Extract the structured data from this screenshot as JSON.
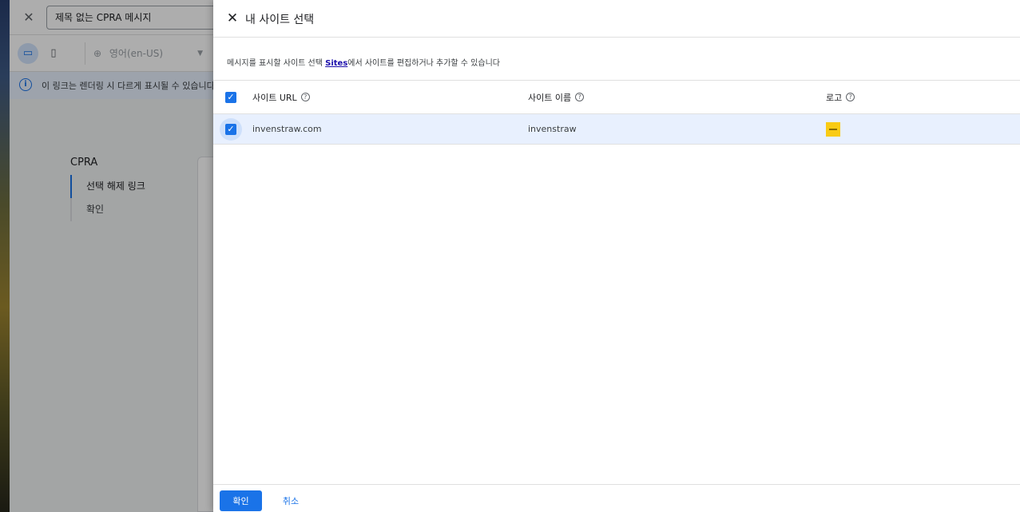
{
  "background_editor": {
    "message_title": "제목 없는 CPRA 메시지",
    "language": "영어(en-US)",
    "info_text": "이 링크는 렌더링 시 다르게 표시될 수 있습니다.",
    "nav": {
      "heading": "CPRA",
      "items": [
        {
          "label": "선택 해제 링크"
        },
        {
          "label": "확인"
        }
      ]
    }
  },
  "dialog": {
    "title": "내 사이트 선택",
    "description_before": "메시지를 표시할 사이트 선택 ",
    "description_link": "Sites",
    "description_after": "에서 사이트를 편집하거나 추가할 수 있습니다",
    "table": {
      "columns": [
        "사이트 URL",
        "사이트 이름",
        "로고"
      ],
      "rows": [
        {
          "url": "invenstraw.com",
          "name": "invenstraw",
          "logo_color": "#f9cb14",
          "selected": true
        }
      ],
      "select_all_checked": true
    },
    "confirm_label": "확인",
    "cancel_label": "취소"
  },
  "icons": {
    "close": "close-icon",
    "desktop": "desktop-icon",
    "mobile": "mobile-icon",
    "globe": "globe-icon",
    "info": "info-icon",
    "help": "help-circle-icon",
    "check": "check-icon"
  },
  "colors": {
    "accent": "#1a73e8",
    "selected_row": "#e8f0fe",
    "info_bar": "#e8f0fe"
  }
}
